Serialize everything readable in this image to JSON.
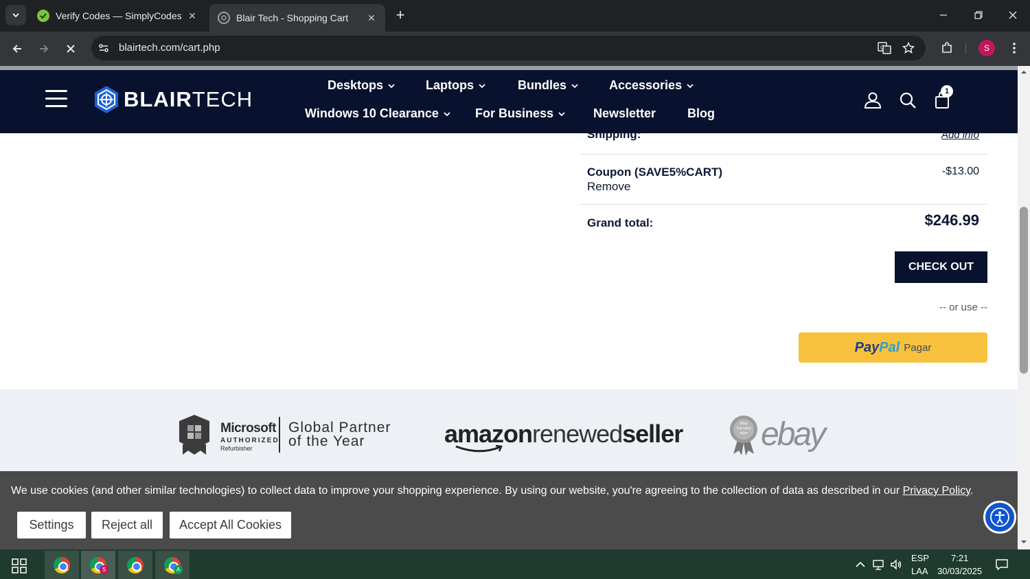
{
  "browser": {
    "tabs": [
      {
        "title": "Verify Codes — SimplyCodes",
        "close": "✕",
        "favicon": "simplycodes-icon"
      },
      {
        "title": "Blair Tech - Shopping Cart",
        "close": "✕",
        "favicon": "blairtech-icon"
      }
    ],
    "new_tab": "+",
    "url": "blairtech.com/cart.php",
    "profile_initial": "S",
    "colors": {
      "frame": "#202124",
      "toolbar": "#35363a",
      "profile": "#c2185b"
    }
  },
  "site": {
    "logo_text_bold": "BLAIR",
    "logo_text_light": "TECH",
    "nav_row1": [
      "Desktops",
      "Laptops",
      "Bundles",
      "Accessories"
    ],
    "nav_row2": [
      "Windows 10 Clearance",
      "For Business",
      "Newsletter",
      "Blog"
    ],
    "cart_count": "1",
    "colors": {
      "header_bg": "#08122e",
      "primary": "#08122e"
    }
  },
  "summary": {
    "shipping_label": "Shipping:",
    "shipping_action": "Add info",
    "coupon_label": "Coupon (SAVE5%CART)",
    "coupon_remove": "Remove",
    "coupon_amount": "-$13.00",
    "grand_total_label": "Grand total:",
    "grand_total_value": "$246.99",
    "checkout_label": "CHECK OUT",
    "or_use": "-- or use --",
    "paypal_part1": "Pay",
    "paypal_part2": "Pal",
    "paypal_pagar": "Pagar",
    "colors": {
      "paypal_bg": "#f8c13d"
    }
  },
  "partners": {
    "microsoft_name": "Microsoft",
    "microsoft_authorized": "AUTHORIZED",
    "microsoft_refurbisher": "Refurbisher",
    "global_partner_line1": "Global Partner",
    "global_partner_line2": "of the Year",
    "amazon_part1": "amazon",
    "amazon_part2": "renewed",
    "amazon_part3": "seller",
    "ebay_badge_text": "eBay Top-rated seller",
    "ebay_text": "ebay"
  },
  "cookies": {
    "message": "We use cookies (and other similar technologies) to collect data to improve your shopping experience. By using our website, you're agreeing to the collection of data as described in our ",
    "policy_link": "Privacy Policy",
    "message_end": ".",
    "settings_label": "Settings",
    "reject_label": "Reject all",
    "accept_label": "Accept All Cookies"
  },
  "taskbar": {
    "apps": [
      {
        "name": "chrome-icon",
        "badge": ""
      },
      {
        "name": "chrome-icon",
        "badge": "S"
      },
      {
        "name": "chrome-icon",
        "badge": ""
      },
      {
        "name": "chrome-icon",
        "badge": "A"
      }
    ],
    "language": "ESP",
    "layout": "LAA",
    "time": "7:21",
    "date": "30/03/2025"
  }
}
